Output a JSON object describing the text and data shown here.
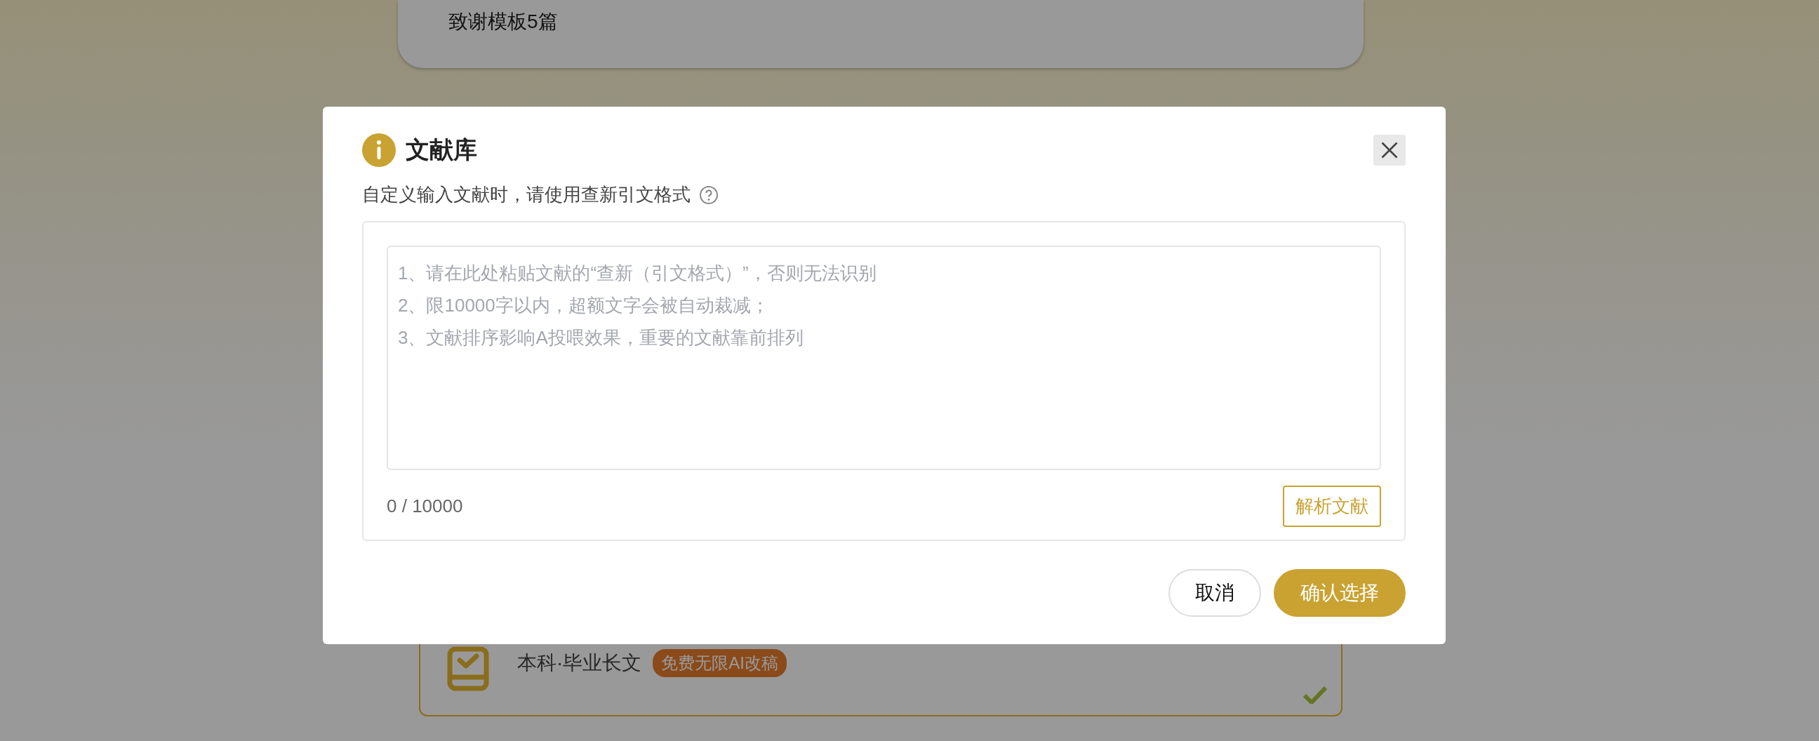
{
  "background_page": {
    "top_card": {
      "text": "致谢模板5篇"
    },
    "paper_card": {
      "selected": true,
      "meta": "本科·毕业长文",
      "tag": "免费无限AI改稿"
    }
  },
  "dialog": {
    "title": "文献库",
    "subtitle": "自定义输入文献时，请使用查新引文格式",
    "input": {
      "placeholder": "1、请在此处粘贴文献的“查新（引文格式）”，否则无法识别\n2、限10000字以内，超额文字会被自动裁减；\n3、文献排序影响A投喂效果，重要的文献靠前排列"
    },
    "counter": "0 / 10000",
    "parse_button": "解析文献",
    "buttons": [
      {
        "kind": "secondary",
        "label": "取消"
      },
      {
        "kind": "primary",
        "label": "确认选择"
      }
    ]
  }
}
